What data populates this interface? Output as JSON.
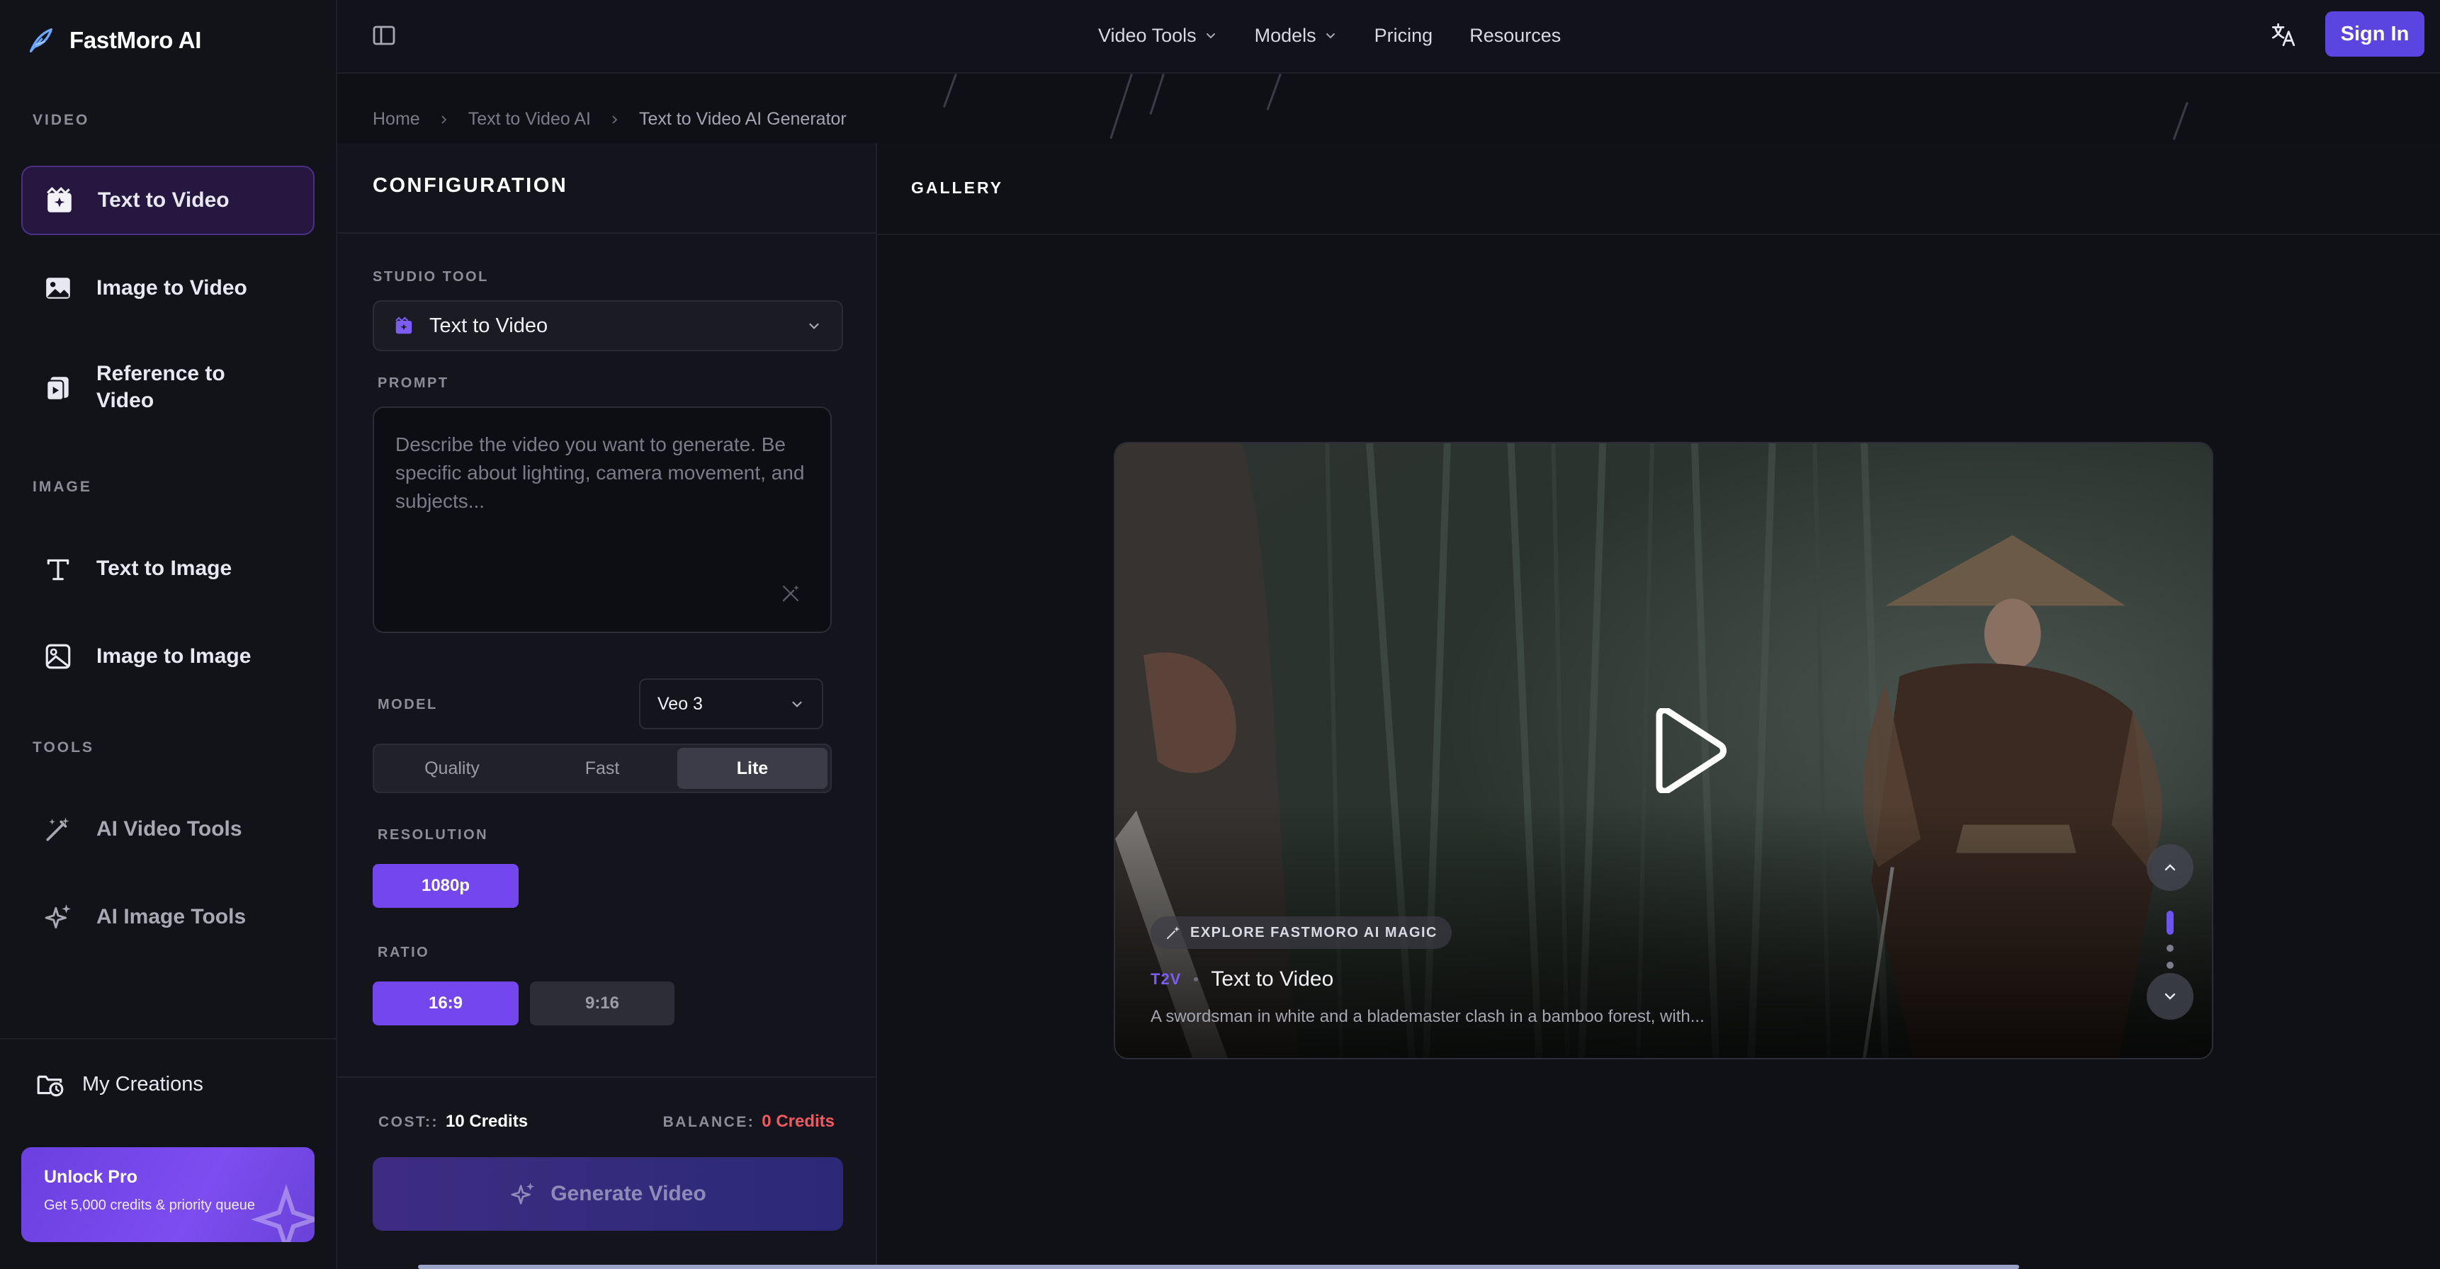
{
  "brand": {
    "name": "FastMoro AI"
  },
  "sidebar": {
    "sections": {
      "video": "VIDEO",
      "image": "IMAGE",
      "tools": "TOOLS"
    },
    "items": [
      {
        "label": "Text to Video",
        "icon": "clapperboard-icon",
        "active": true
      },
      {
        "label": "Image to Video",
        "icon": "image-icon"
      },
      {
        "label": "Reference to Video",
        "icon": "reference-video-icon"
      },
      {
        "label": "Text to Image",
        "icon": "text-type-icon"
      },
      {
        "label": "Image to Image",
        "icon": "image-icon"
      },
      {
        "label": "AI Video Tools",
        "icon": "magic-wand-icon"
      },
      {
        "label": "AI Image Tools",
        "icon": "sparkles-icon"
      }
    ],
    "my_creations": "My Creations",
    "pro": {
      "title": "Unlock Pro",
      "subtitle": "Get 5,000 credits & priority queue"
    }
  },
  "topbar": {
    "nav": [
      "Video Tools",
      "Models",
      "Pricing",
      "Resources"
    ],
    "sign_in": "Sign In"
  },
  "breadcrumb": [
    "Home",
    "Text to Video AI",
    "Text to Video AI Generator"
  ],
  "config": {
    "title": "CONFIGURATION",
    "studio_tool_label": "STUDIO TOOL",
    "studio_tool_value": "Text to Video",
    "prompt_label": "PROMPT",
    "prompt_placeholder": "Describe the video you want to generate. Be specific about lighting, camera movement, and subjects...",
    "prompt_value": "",
    "model_label": "MODEL",
    "model_value": "Veo 3",
    "modes": [
      "Quality",
      "Fast",
      "Lite"
    ],
    "mode_selected": "Lite",
    "resolution_label": "RESOLUTION",
    "resolutions": [
      "1080p"
    ],
    "ratio_label": "RATIO",
    "ratios": [
      "16:9",
      "9:16"
    ],
    "ratio_selected": "16:9",
    "cost_label": "COST::",
    "cost_value": "10 Credits",
    "balance_label": "BALANCE:",
    "balance_value": "0 Credits",
    "generate_label": "Generate Video"
  },
  "gallery": {
    "title": "GALLERY",
    "badge": "EXPLORE FASTMORO AI MAGIC",
    "tag": "T2V",
    "item_title": "Text to Video",
    "description": "A swordsman in white and a blademaster clash in a bamboo forest, with..."
  },
  "colors": {
    "accent": "#7346ee",
    "sign_in": "#5a45e0",
    "balance_warning": "#ef5a62",
    "tag": "#7d5cf3"
  }
}
